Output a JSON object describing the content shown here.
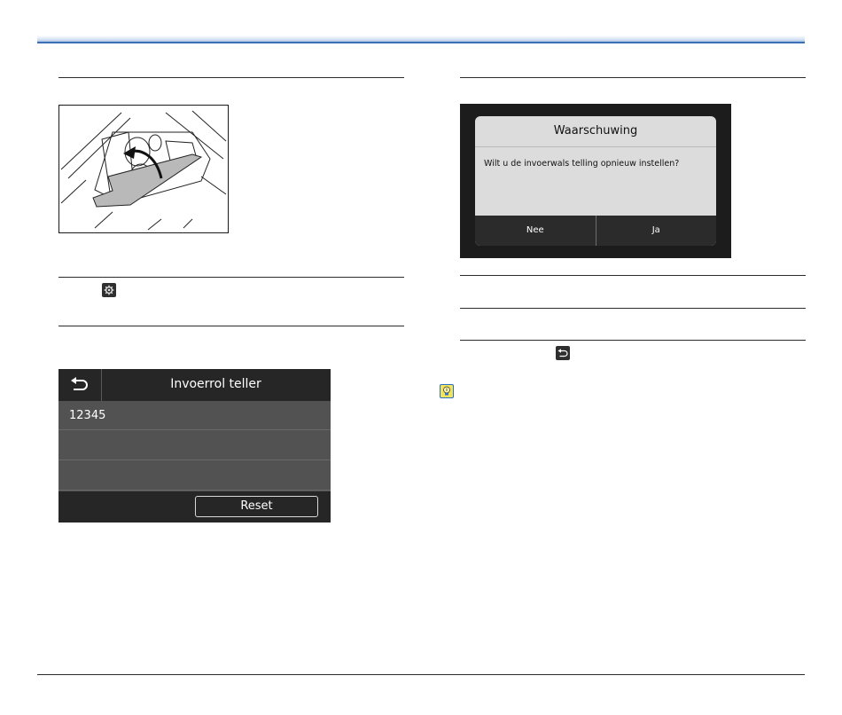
{
  "colors": {
    "accent_blue": "#3b6fb6",
    "screen_dark": "#262626",
    "row_gray": "#525252",
    "dialog_bg": "#dcdcdc",
    "hint_yellow": "#f3e55a"
  },
  "icons": {
    "settings": "gear-icon",
    "back": "back-arrow-icon",
    "hint": "lightbulb-icon"
  },
  "counter_screen": {
    "title": "Invoerrol teller",
    "rows": [
      "12345",
      "",
      ""
    ],
    "reset_label": "Reset"
  },
  "warning_dialog": {
    "title": "Waarschuwing",
    "message": "Wilt u de invoerwals telling opnieuw instellen?",
    "no_label": "Nee",
    "yes_label": "Ja"
  }
}
